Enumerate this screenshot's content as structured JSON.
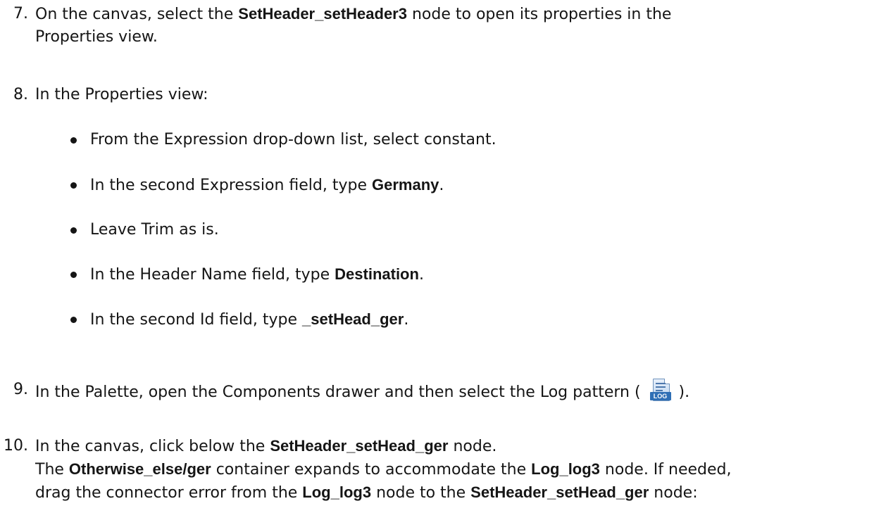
{
  "step7": {
    "number": "7.",
    "t1": "On the canvas, select the ",
    "node": "SetHeader_setHeader3",
    "t2": " node to open its properties in the",
    "view": "Properties",
    "t3": " view."
  },
  "step8": {
    "number": "8.",
    "t1": "In the ",
    "view": "Properties",
    "t2": " view:",
    "bullets": [
      {
        "a": "From the ",
        "b": "Expression",
        "c": " drop-down list, select ",
        "d": "constant",
        "e": "."
      },
      {
        "a": "In the second ",
        "b": "Expression",
        "c": " field, type ",
        "d": "Germany",
        "e": "."
      },
      {
        "a": "Leave ",
        "b": "Trim",
        "c": " as is."
      },
      {
        "a": "In the ",
        "b": "Header Name",
        "c": " field, type ",
        "d": "Destination",
        "e": "."
      },
      {
        "a": "In the second ",
        "b": "Id",
        "c": " field, type ",
        "d": "_setHead_ger",
        "e": "."
      }
    ]
  },
  "step9": {
    "number": "9.",
    "t1": "In the ",
    "palette": "Palette",
    "t2": ", open the ",
    "drawer": "Components",
    "t3": " drawer and then select the ",
    "pattern": "Log",
    "t4": " pattern ( ",
    "icon": "log-pattern-icon",
    "icon_label": "LOG",
    "t5": " )."
  },
  "step10": {
    "number": "10.",
    "l1a": "In the canvas, click below the ",
    "l1b": "SetHeader_setHead_ger",
    "l1c": " node.",
    "l2a": "The ",
    "l2b": "Otherwise_else/ger",
    "l2c": " container expands to accommodate the ",
    "l2d": "Log_log3",
    "l2e": " node. If needed,",
    "l3a": "drag the connector error from the ",
    "l3b": "Log_log3",
    "l3c": " node to the ",
    "l3d": "SetHeader_setHead_ger",
    "l3e": " node:"
  }
}
